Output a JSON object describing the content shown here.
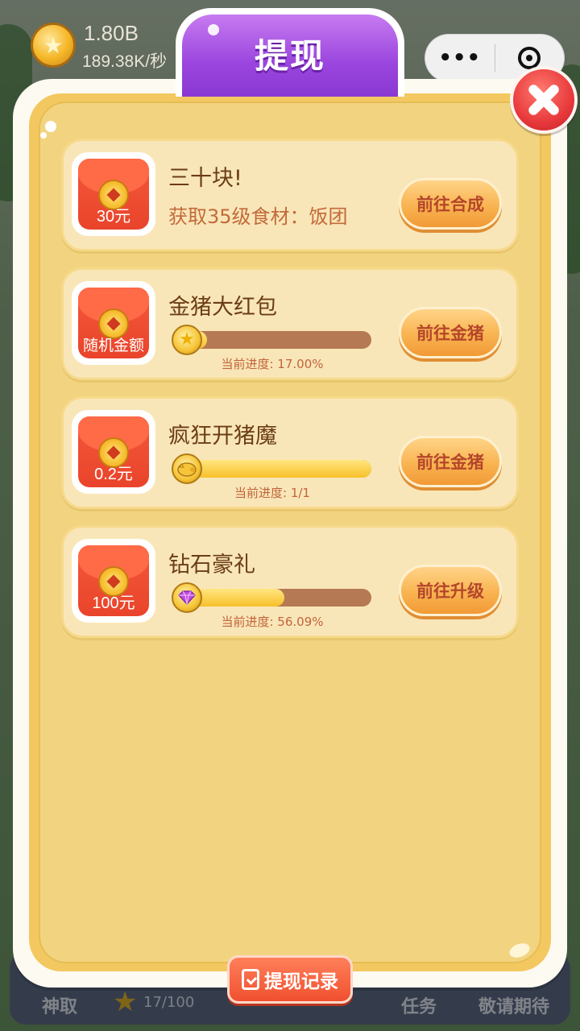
{
  "header": {
    "coins": "1.80B",
    "rate": "189.38K/秒",
    "title": "提现"
  },
  "capsule": {
    "more_icon": "more-dots-icon",
    "close_icon": "target-icon"
  },
  "tasks": [
    {
      "title": "三十块!",
      "subtitle": "获取35级食材：饭团",
      "reward": "30元",
      "button": "前往合成"
    },
    {
      "title": "金猪大红包",
      "reward": "随机金额",
      "icon": "star-icon",
      "progress": 0.17,
      "progress_text": "当前进度: 17.00%",
      "button": "前往金猪"
    },
    {
      "title": "疯狂开猪魔",
      "reward": "0.2元",
      "icon": "pig-icon",
      "progress": 1.0,
      "progress_text": "当前进度: 1/1",
      "button": "前往金猪"
    },
    {
      "title": "钻石豪礼",
      "reward": "100元",
      "icon": "diamond-icon",
      "progress": 0.5609,
      "progress_text": "当前进度: 56.09%",
      "button": "前往升级"
    }
  ],
  "footer": {
    "record_label": "提现记录"
  },
  "bottom_nav": {
    "left": "神取",
    "count": "17/100",
    "task": "任务",
    "right": "敬请期待"
  },
  "colors": {
    "title_purple": "#9a45de",
    "panel_yellow": "#f2d480",
    "button_orange": "#f9b451",
    "close_red": "#e83a3c"
  }
}
